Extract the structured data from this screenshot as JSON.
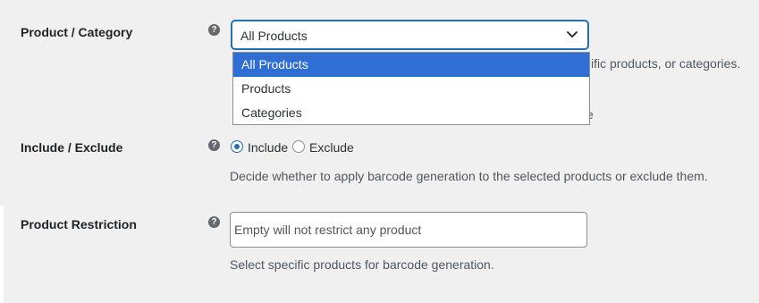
{
  "product_category": {
    "label": "Product / Category",
    "help_icon": "?",
    "select_value": "All Products",
    "options": [
      "All Products",
      "Products",
      "Categories"
    ],
    "obscured_description_tail": "ific products, or categories.",
    "obscured_char": "e"
  },
  "include_exclude": {
    "label": "Include / Exclude",
    "help_icon": "?",
    "options": [
      {
        "label": "Include",
        "checked": true
      },
      {
        "label": "Exclude",
        "checked": false
      }
    ],
    "description": "Decide whether to apply barcode generation to the selected products or exclude them."
  },
  "product_restriction": {
    "label": "Product Restriction",
    "help_icon": "?",
    "placeholder": "Empty will not restrict any product",
    "description": "Select specific products for barcode generation."
  },
  "colors": {
    "selected_option_bg": "#2e6ed5",
    "focus_border": "#2271b1",
    "page_bg": "#f0f0f1"
  }
}
